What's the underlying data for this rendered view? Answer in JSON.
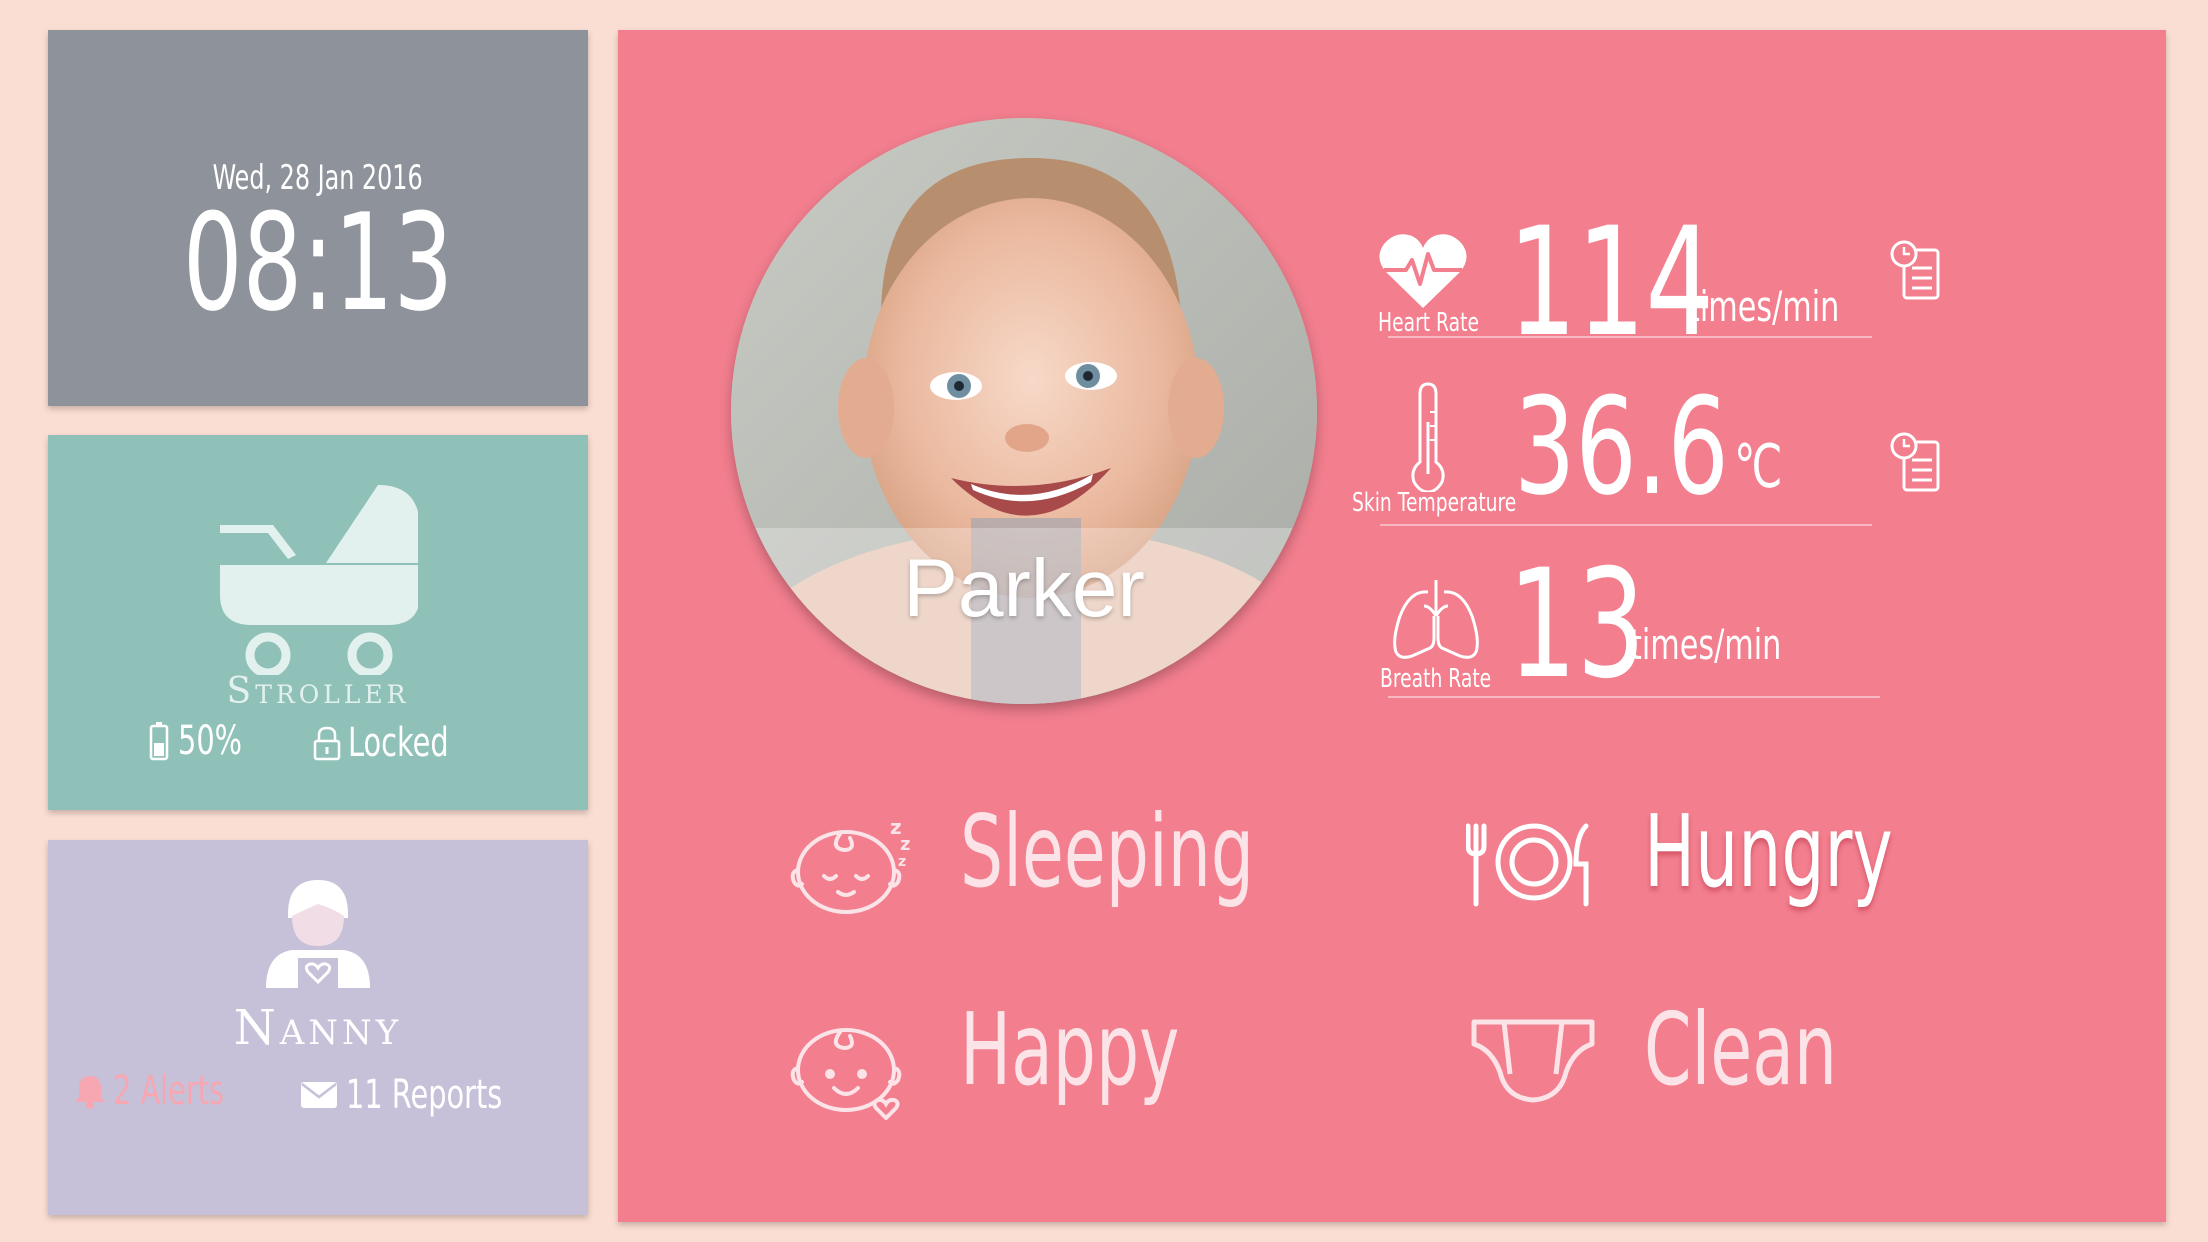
{
  "clock": {
    "date": "Wed,  28 Jan 2016",
    "time": "08:13"
  },
  "stroller": {
    "title": "Stroller",
    "battery": "50%",
    "lock_status": "Locked"
  },
  "nanny": {
    "title": "Nanny",
    "alerts": "2 Alerts",
    "reports": "11 Reports"
  },
  "baby": {
    "name": "Parker"
  },
  "vitals": {
    "heart_rate": {
      "label": "Heart Rate",
      "value": "114",
      "unit": "times/min"
    },
    "skin_temperature": {
      "label": "Skin Temperature",
      "value": "36.6",
      "unit": "℃"
    },
    "breath_rate": {
      "label": "Breath Rate",
      "value": "13",
      "unit": "times/min"
    }
  },
  "status": {
    "sleeping": "Sleeping",
    "hungry": "Hungry",
    "happy": "Happy",
    "clean": "Clean"
  },
  "colors": {
    "background": "#fbded3",
    "clock_panel": "#8e939b",
    "stroller_panel": "#90c1b8",
    "nanny_panel": "#c6c1d9",
    "main_panel": "#f27e8e",
    "alert_color": "#f7a7b1"
  },
  "icons": {
    "stroller": "stroller-icon",
    "battery": "battery-icon",
    "lock": "lock-icon",
    "nanny": "nanny-icon",
    "bell": "bell-icon",
    "mail": "mail-icon",
    "heart_rate": "heart-rate-icon",
    "thermometer": "thermometer-icon",
    "lungs": "lungs-icon",
    "report": "report-icon",
    "sleeping_face": "sleeping-face-icon",
    "happy_face": "happy-face-icon",
    "plate": "plate-cutlery-icon",
    "diaper": "diaper-icon"
  }
}
